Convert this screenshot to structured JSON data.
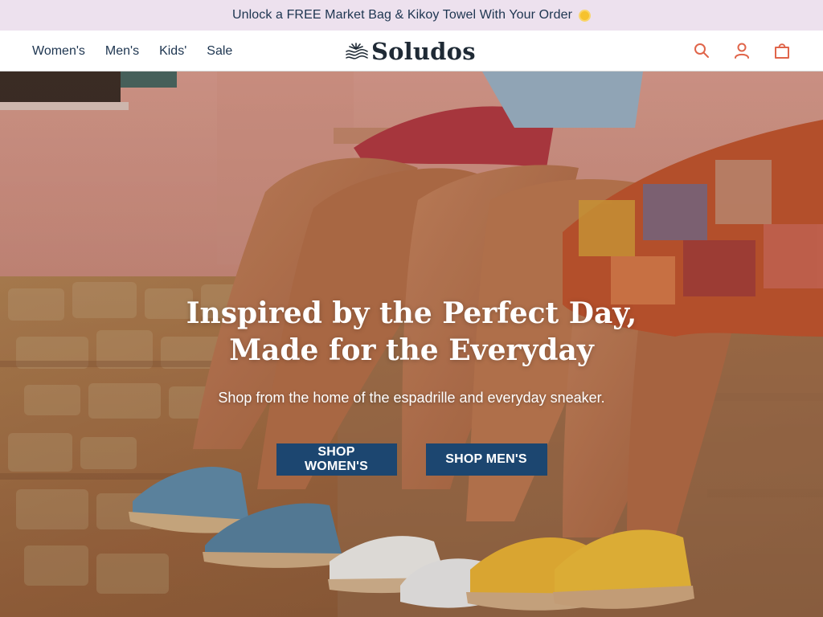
{
  "promo": {
    "text": "Unlock a FREE Market Bag & Kikoy Towel With Your Order",
    "icon": "sun-icon"
  },
  "nav": {
    "items": [
      "Women's",
      "Men's",
      "Kids'",
      "Sale"
    ]
  },
  "logo": {
    "text": "Soludos"
  },
  "header_icons": [
    "search-icon",
    "account-icon",
    "bag-icon"
  ],
  "hero": {
    "title_line1": "Inspired by the Perfect Day,",
    "title_line2": "Made for the Everyday",
    "subtitle": "Shop from the home of the espadrille and everyday sneaker.",
    "cta_women": "SHOP WOMEN'S",
    "cta_men": "SHOP MEN'S"
  },
  "colors": {
    "navy": "#1d3550",
    "button": "#1c4670",
    "promo_bg": "#ede1ee",
    "accent": "#e0654a"
  }
}
